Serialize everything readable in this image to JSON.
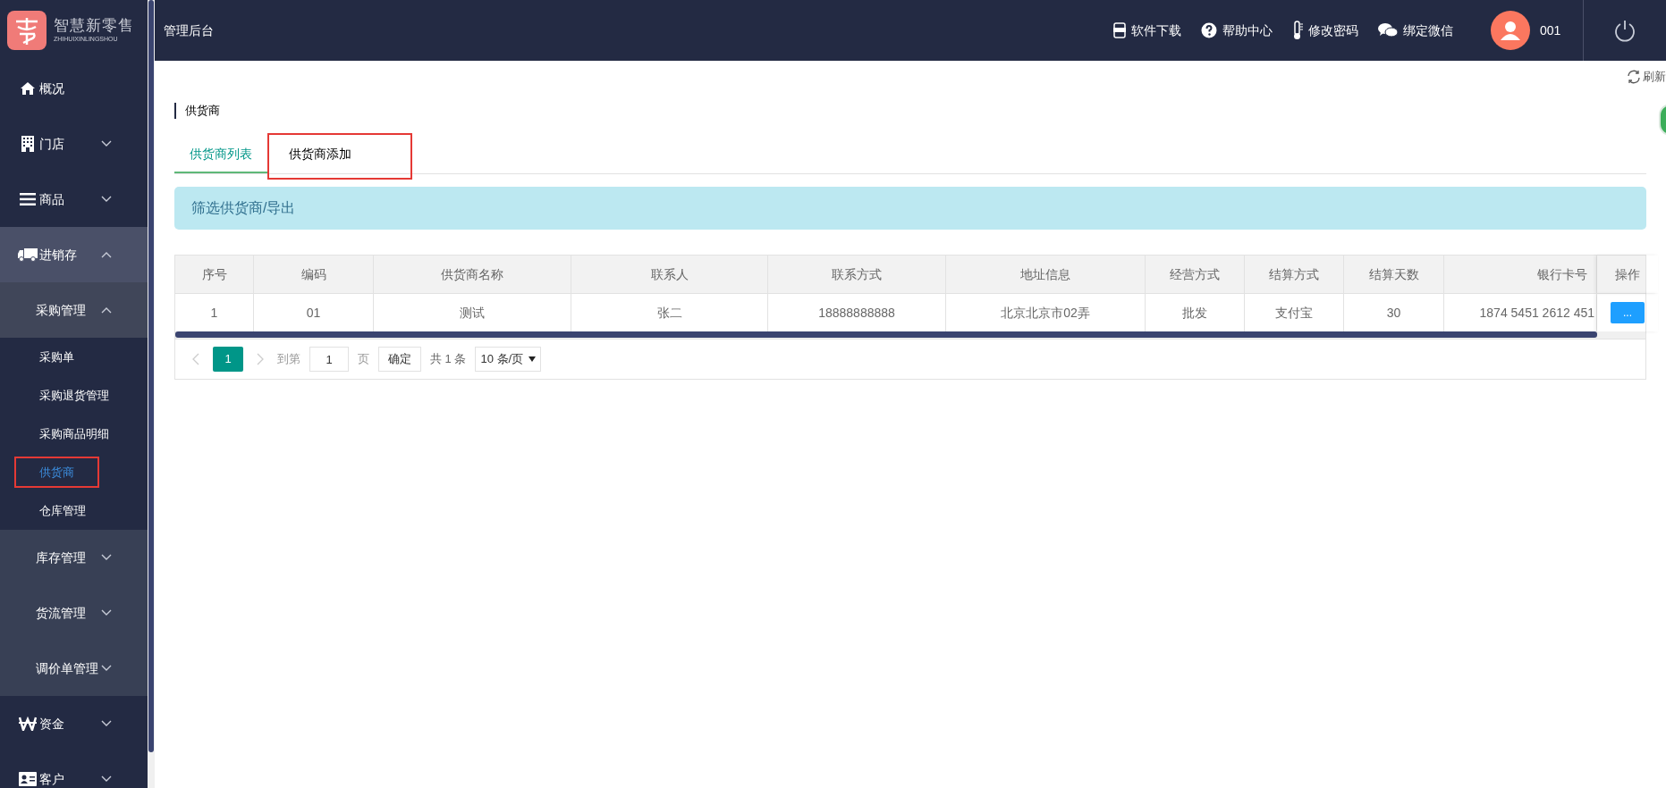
{
  "brand": {
    "name": "智慧新零售",
    "subtitle": "ZHIHUIXINLINGSHOU"
  },
  "header": {
    "title": "管理后台",
    "links": [
      "软件下载",
      "帮助中心",
      "修改密码",
      "绑定微信"
    ],
    "user": "001"
  },
  "sidebar": {
    "items": [
      {
        "label": "概况"
      },
      {
        "label": "门店",
        "expanded": false
      },
      {
        "label": "商品",
        "expanded": false
      },
      {
        "label": "进销存",
        "expanded": true,
        "children": [
          {
            "label": "采购管理",
            "expanded": true,
            "children": [
              {
                "label": "采购单",
                "selected": false
              },
              {
                "label": "采购退货管理",
                "selected": false
              },
              {
                "label": "采购商品明细",
                "selected": false
              },
              {
                "label": "供货商",
                "selected": true
              },
              {
                "label": "仓库管理",
                "selected": false
              }
            ]
          },
          {
            "label": "库存管理",
            "expanded": false
          },
          {
            "label": "货流管理",
            "expanded": false
          },
          {
            "label": "调价单管理",
            "expanded": false
          }
        ]
      },
      {
        "label": "资金",
        "expanded": false
      },
      {
        "label": "客户",
        "expanded": false
      }
    ]
  },
  "refresh": "刷新",
  "page_title": "供货商",
  "tabs": [
    {
      "label": "供货商列表",
      "selected": true
    },
    {
      "label": "供货商添加",
      "selected": false
    }
  ],
  "filter_bar": "筛选供货商/导出",
  "table": {
    "columns": [
      "序号",
      "编码",
      "供货商名称",
      "联系人",
      "联系方式",
      "地址信息",
      "经营方式",
      "结算方式",
      "结算天数",
      "银行卡号",
      "操作"
    ],
    "rows": [
      {
        "cells": [
          "1",
          "01",
          "测试",
          "张二",
          "18888888888",
          "北京北京市02弄",
          "批发",
          "支付宝",
          "30",
          "1874 5451 2612 451"
        ],
        "action": "..."
      }
    ]
  },
  "pager": {
    "pages": [
      {
        "label": "1",
        "selected": true
      }
    ],
    "goto_label": "到第",
    "goto_value": "1",
    "page_unit": "页",
    "confirm": "确定",
    "total": "共 1 条",
    "page_size": "10 条/页"
  }
}
